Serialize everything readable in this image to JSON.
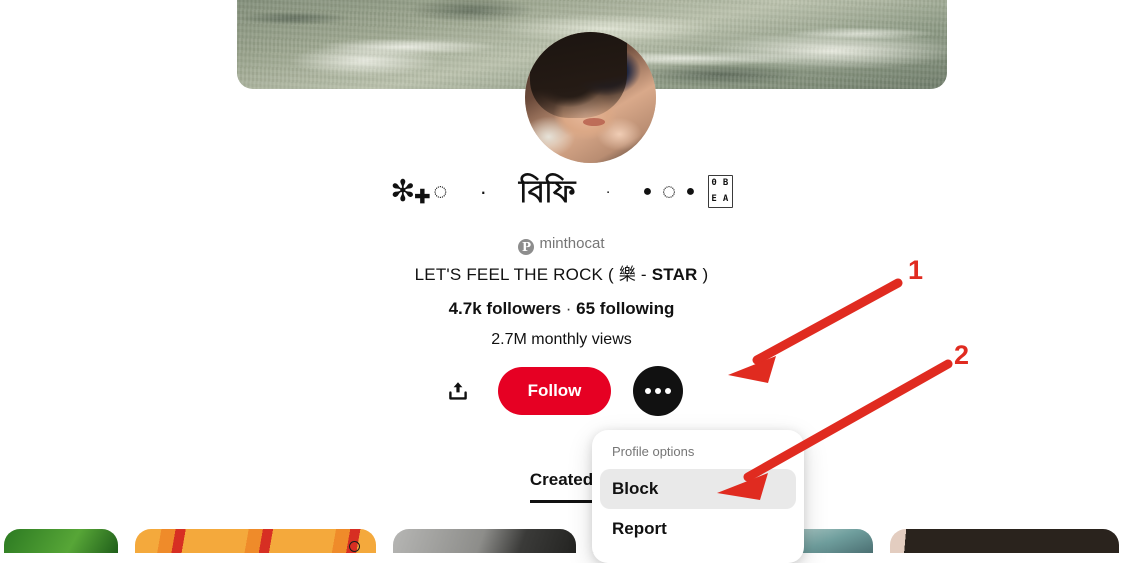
{
  "profile": {
    "banner_alt": "beach-foam-banner",
    "avatar_alt": "profile-portrait",
    "display_name_parts": [
      {
        "type": "sparkle",
        "char": "✻"
      },
      {
        "type": "plus",
        "char": "✚"
      },
      {
        "type": "dotted-circle",
        "char": "◌"
      },
      {
        "type": "middot",
        "char": "·"
      },
      {
        "type": "butterfly",
        "char": "বিফি"
      },
      {
        "type": "small-dot",
        "char": "·"
      },
      {
        "type": "filled-circle-small",
        "char": "●"
      },
      {
        "type": "dotted-circle",
        "char": "◌"
      },
      {
        "type": "filled-circle-small",
        "char": "●"
      },
      {
        "type": "tofu-box",
        "hex": [
          "0",
          "B",
          "E",
          "A"
        ]
      }
    ],
    "username": "minthocat",
    "username_icon": "pinterest-badge-icon",
    "bio": "LET'S FEEL THE ROCK ( 樂 - STAR )",
    "bio_prefix": "LET'S FEEL THE ROCK ( 樂 - ",
    "bio_bold": "STAR",
    "bio_suffix": " )",
    "followers": "4.7k followers",
    "stats_separator": "·",
    "following": "65 following",
    "monthly_views": "2.7M monthly views"
  },
  "actions": {
    "share_icon": "share-upload-icon",
    "follow_label": "Follow",
    "follow_color": "#e60023",
    "more_icon": "more-options-icon",
    "more_color": "#111111"
  },
  "tabs": [
    {
      "label": "Created",
      "active": true
    }
  ],
  "dropdown": {
    "title": "Profile options",
    "items": [
      {
        "label": "Block",
        "highlighted": true
      },
      {
        "label": "Report",
        "highlighted": false
      }
    ]
  },
  "annotations": {
    "accent_color": "#e02b20",
    "markers": [
      {
        "number": "1",
        "target": "more-options-button"
      },
      {
        "number": "2",
        "target": "dropdown-item-block"
      }
    ]
  },
  "pin_grid": [
    {
      "name": "pin-green",
      "color": "#3f8f2e"
    },
    {
      "name": "pin-orange",
      "color": "#f0a33a"
    },
    {
      "name": "pin-grayscale",
      "color": "#9a9a98"
    },
    {
      "name": "pin-dark",
      "color": "#2e2e2c"
    },
    {
      "name": "pin-teal",
      "color": "#7fa8a6"
    },
    {
      "name": "pin-black",
      "color": "#241f1b"
    }
  ]
}
